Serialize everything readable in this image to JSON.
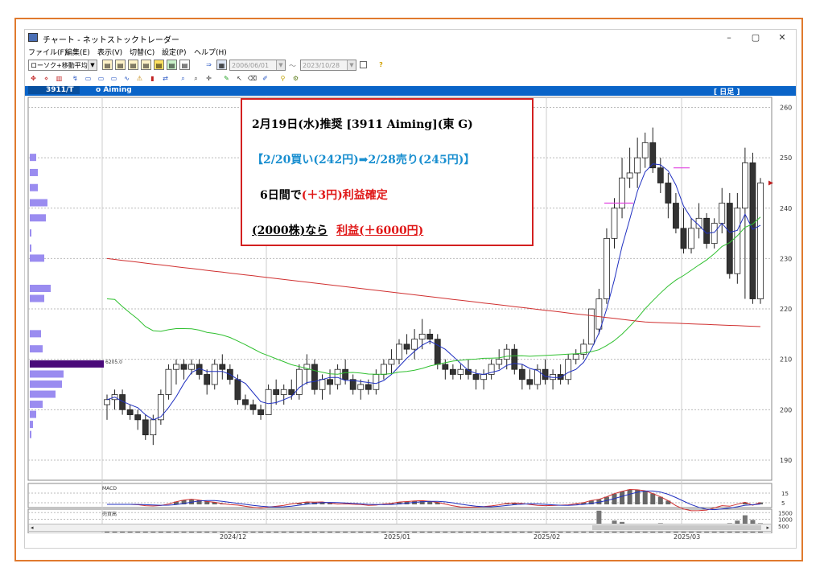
{
  "window": {
    "title": "チャート - ネットストックトレーダー",
    "controls": [
      "–",
      "▢",
      "✕"
    ]
  },
  "menu": [
    "ファイル(F)",
    "編集(E)",
    "表示(V)",
    "切替(C)",
    "設定(P)",
    "ヘルプ(H)"
  ],
  "toolbar": {
    "chart_type": "ローソク+移動平均",
    "start_date": "2006/06/01",
    "end_date": "2023/10/28",
    "range_sep": "～",
    "help": "?"
  },
  "chart_header": {
    "symbol": "3911/T",
    "name": "o Aiming",
    "period": "[ 日足 ]"
  },
  "panels": {
    "macd_label": "MACD",
    "volume_label": "売買高",
    "volume_marker": "6205.0"
  },
  "x_labels": [
    "2024/12",
    "2025/01",
    "2025/02",
    "2025/03"
  ],
  "note": {
    "line1": "2月19日(水)推奨 [3911 Aiming](東 G)",
    "line2": "【2/20買い(242円)➡2/28売り(245円)】",
    "line3_pre": "6日間で",
    "line3_red": "(＋3円)利益確定",
    "line4_pre": "(2000株)なら",
    "line4_red": "利益(＋6000円)"
  },
  "colors": {
    "accent": "#0a64c8",
    "up": "#ffffff",
    "down": "#333333",
    "ma_short": "#2030c0",
    "ma_mid": "#30c030",
    "ma_long": "#d03030",
    "note_border": "#d32020",
    "note_blue": "#1a8fd0",
    "note_red": "#e01818",
    "frame": "#e07a2e",
    "volume_profile": "#9a8cf0",
    "volume_profile_peak": "#4a0a7a"
  },
  "chart_data": {
    "type": "candlestick",
    "price_axis": {
      "ticks": [
        190,
        200,
        210,
        220,
        230,
        240,
        250,
        260
      ],
      "ylim": [
        186,
        262
      ]
    },
    "macd_axis": {
      "ticks": [
        5,
        15
      ]
    },
    "volume_axis": {
      "ticks": [
        500,
        1000,
        1500
      ]
    },
    "candles": [
      [
        201,
        203,
        198,
        202
      ],
      [
        202,
        204,
        200,
        203
      ],
      [
        203,
        204,
        199,
        200
      ],
      [
        200,
        201,
        198,
        199
      ],
      [
        199,
        200,
        196,
        198
      ],
      [
        198,
        199,
        194,
        195
      ],
      [
        195,
        199,
        193,
        198
      ],
      [
        198,
        204,
        197,
        203
      ],
      [
        203,
        209,
        202,
        208
      ],
      [
        208,
        210,
        205,
        209
      ],
      [
        209,
        210,
        206,
        208
      ],
      [
        208,
        210,
        207,
        209
      ],
      [
        209,
        210,
        206,
        207
      ],
      [
        207,
        208,
        203,
        205
      ],
      [
        205,
        210,
        204,
        209
      ],
      [
        209,
        211,
        206,
        208
      ],
      [
        208,
        209,
        205,
        206
      ],
      [
        206,
        207,
        201,
        202
      ],
      [
        202,
        203,
        200,
        201
      ],
      [
        201,
        202,
        199,
        200
      ],
      [
        200,
        201,
        198,
        199
      ],
      [
        199,
        205,
        199,
        204
      ],
      [
        204,
        206,
        201,
        203
      ],
      [
        203,
        205,
        201,
        204
      ],
      [
        204,
        206,
        202,
        203
      ],
      [
        203,
        209,
        202,
        208
      ],
      [
        208,
        211,
        205,
        209
      ],
      [
        209,
        210,
        203,
        204
      ],
      [
        204,
        207,
        202,
        206
      ],
      [
        206,
        208,
        203,
        205
      ],
      [
        205,
        209,
        204,
        208
      ],
      [
        208,
        210,
        205,
        206
      ],
      [
        206,
        207,
        203,
        204
      ],
      [
        204,
        206,
        202,
        205
      ],
      [
        205,
        206,
        203,
        204
      ],
      [
        204,
        208,
        203,
        207
      ],
      [
        207,
        210,
        206,
        209
      ],
      [
        209,
        212,
        207,
        210
      ],
      [
        210,
        214,
        209,
        213
      ],
      [
        213,
        215,
        211,
        212
      ],
      [
        212,
        216,
        210,
        214
      ],
      [
        214,
        218,
        212,
        215
      ],
      [
        215,
        216,
        213,
        214
      ],
      [
        214,
        215,
        208,
        209
      ],
      [
        209,
        210,
        206,
        208
      ],
      [
        208,
        209,
        206,
        207
      ],
      [
        207,
        209,
        206,
        208
      ],
      [
        208,
        210,
        206,
        207
      ],
      [
        207,
        208,
        204,
        206
      ],
      [
        206,
        208,
        204,
        207
      ],
      [
        207,
        210,
        206,
        209
      ],
      [
        209,
        212,
        208,
        210
      ],
      [
        210,
        213,
        208,
        212
      ],
      [
        212,
        213,
        207,
        208
      ],
      [
        208,
        209,
        204,
        206
      ],
      [
        206,
        208,
        204,
        205
      ],
      [
        205,
        209,
        204,
        208
      ],
      [
        208,
        210,
        205,
        206
      ],
      [
        206,
        208,
        204,
        207
      ],
      [
        207,
        209,
        205,
        206
      ],
      [
        206,
        211,
        205,
        210
      ],
      [
        210,
        212,
        209,
        211
      ],
      [
        211,
        214,
        210,
        213
      ],
      [
        213,
        215,
        218,
        220
      ],
      [
        216,
        224,
        215,
        222
      ],
      [
        222,
        236,
        221,
        234
      ],
      [
        234,
        242,
        232,
        240
      ],
      [
        240,
        250,
        238,
        246
      ],
      [
        246,
        252,
        244,
        247
      ],
      [
        247,
        254,
        244,
        250
      ],
      [
        250,
        255,
        248,
        253
      ],
      [
        253,
        256,
        247,
        248
      ],
      [
        248,
        250,
        243,
        245
      ],
      [
        245,
        247,
        238,
        241
      ],
      [
        241,
        243,
        235,
        236
      ],
      [
        236,
        240,
        231,
        232
      ],
      [
        232,
        238,
        231,
        236
      ],
      [
        236,
        241,
        234,
        238
      ],
      [
        238,
        239,
        232,
        233
      ],
      [
        233,
        238,
        232,
        237
      ],
      [
        237,
        244,
        235,
        241
      ],
      [
        241,
        243,
        226,
        227
      ],
      [
        227,
        243,
        225,
        240
      ],
      [
        240,
        252,
        222,
        249
      ],
      [
        249,
        251,
        221,
        222
      ],
      [
        222,
        246,
        221,
        245
      ]
    ],
    "volume": [
      300,
      250,
      280,
      240,
      260,
      300,
      320,
      350,
      300,
      280,
      260,
      240,
      250,
      270,
      300,
      280,
      260,
      240,
      230,
      250,
      260,
      240,
      280,
      300,
      320,
      290,
      270,
      250,
      280,
      300,
      310,
      290,
      260,
      280,
      300,
      320,
      500,
      340,
      300,
      280,
      260,
      300,
      320,
      310,
      290,
      270,
      260,
      280,
      300,
      310,
      330,
      360,
      300,
      280,
      270,
      290,
      310,
      300,
      280,
      260,
      300,
      320,
      340,
      360,
      1650,
      420,
      900,
      800,
      500,
      450,
      520,
      600,
      700,
      650,
      500,
      400,
      380,
      420,
      500,
      520,
      600,
      700,
      900,
      1300,
      950,
      700
    ]
  }
}
